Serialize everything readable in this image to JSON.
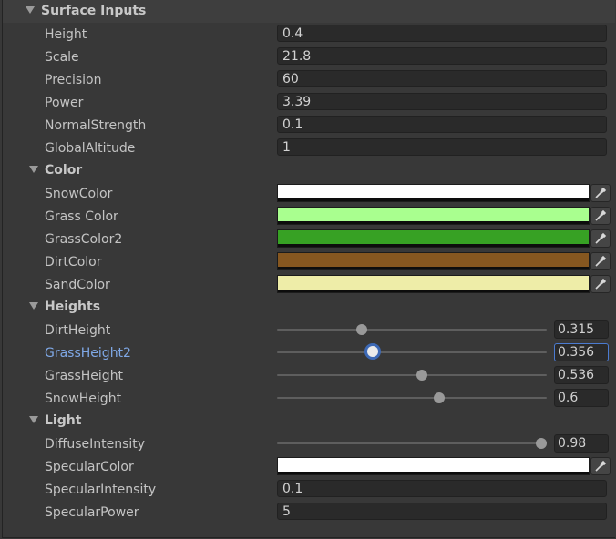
{
  "sections": {
    "surface": {
      "title": "Surface Inputs",
      "rows": [
        {
          "label": "Height",
          "value": "0.4"
        },
        {
          "label": "Scale",
          "value": "21.8"
        },
        {
          "label": "Precision",
          "value": "60"
        },
        {
          "label": "Power",
          "value": "3.39"
        },
        {
          "label": "NormalStrength",
          "value": "0.1"
        },
        {
          "label": "GlobalAltitude",
          "value": "1"
        }
      ]
    },
    "color": {
      "title": "Color",
      "rows": [
        {
          "label": "SnowColor",
          "color": "#ffffff"
        },
        {
          "label": "Grass Color",
          "color": "#a9ff8f"
        },
        {
          "label": "GrassColor2",
          "color": "#37a124"
        },
        {
          "label": "DirtColor",
          "color": "#865720"
        },
        {
          "label": "SandColor",
          "color": "#eeeda8"
        }
      ]
    },
    "heights": {
      "title": "Heights",
      "rows": [
        {
          "label": "DirtHeight",
          "value": "0.315",
          "fraction": 0.315
        },
        {
          "label": "GrassHeight2",
          "value": "0.356",
          "fraction": 0.356
        },
        {
          "label": "GrassHeight",
          "value": "0.536",
          "fraction": 0.536
        },
        {
          "label": "SnowHeight",
          "value": "0.6",
          "fraction": 0.6
        }
      ]
    },
    "light": {
      "title": "Light",
      "diffuse": {
        "label": "DiffuseIntensity",
        "value": "0.98",
        "fraction": 0.98
      },
      "specular_color": {
        "label": "SpecularColor",
        "color": "#ffffff"
      },
      "specular_intensity": {
        "label": "SpecularIntensity",
        "value": "0.1"
      },
      "specular_power": {
        "label": "SpecularPower",
        "value": "5"
      }
    }
  },
  "icons": {
    "foldout": "foldout-arrow-icon",
    "picker": "eyedropper-icon"
  },
  "colors": {
    "accent": "#3d69b5",
    "active_label": "#7fa8e6"
  }
}
